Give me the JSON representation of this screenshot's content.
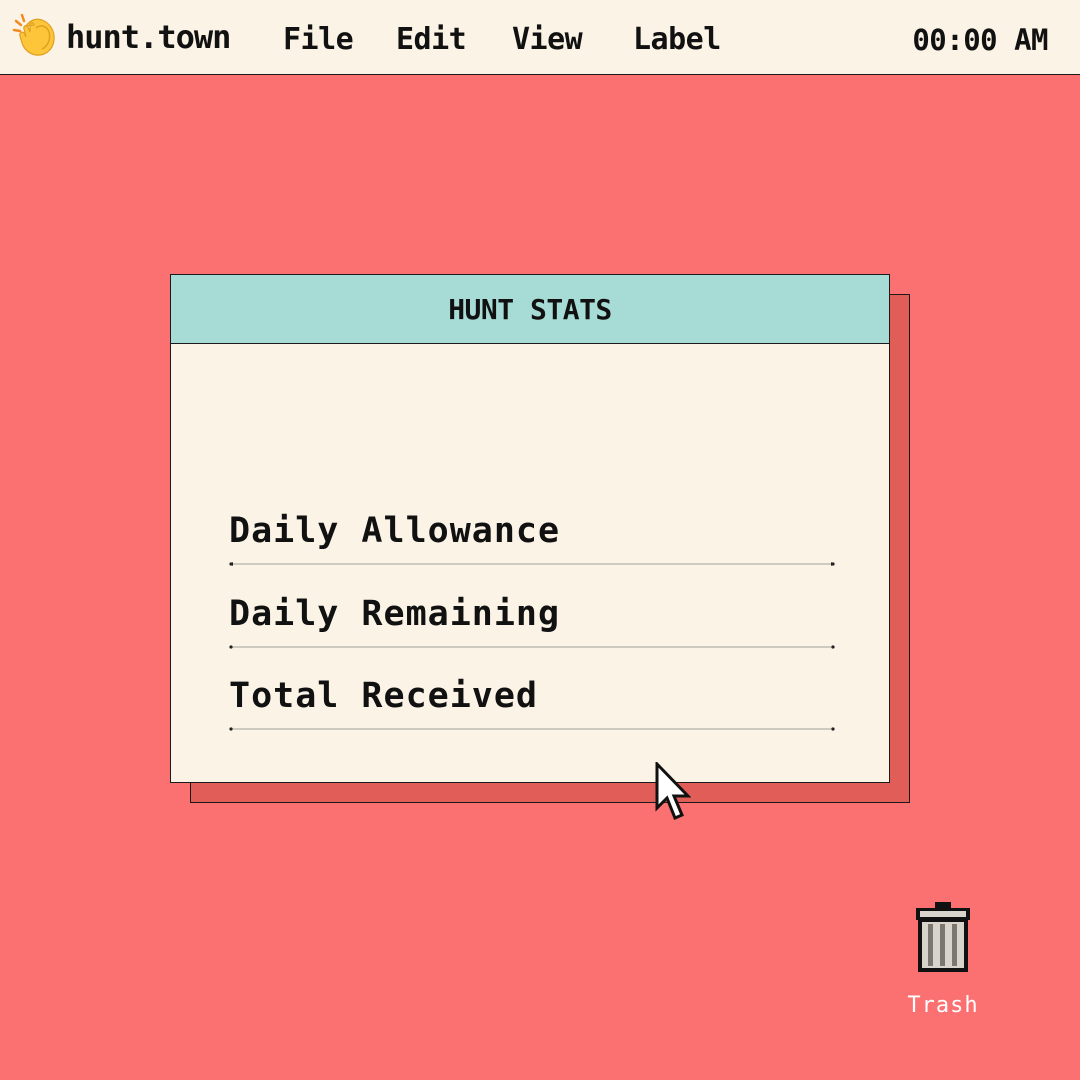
{
  "menubar": {
    "logo_icon": "clapping-hands-icon",
    "brand": "hunt.town",
    "items": [
      {
        "label": "File"
      },
      {
        "label": "Edit"
      },
      {
        "label": "View"
      },
      {
        "label": "Label"
      }
    ],
    "clock": "00:00 AM"
  },
  "window": {
    "title": "HUNT STATS",
    "stats": [
      {
        "label": "Daily Allowance"
      },
      {
        "label": "Daily Remaining"
      },
      {
        "label": "Total Received"
      }
    ]
  },
  "desktop": {
    "trash": {
      "label": "Trash",
      "icon": "trash-can-icon"
    },
    "cursor_icon": "arrow-pointer-icon"
  },
  "colors": {
    "desktop": "#fb7070",
    "panel": "#faf3e6",
    "titlebar": "#a6dbd6",
    "shadow": "#e05d58"
  }
}
